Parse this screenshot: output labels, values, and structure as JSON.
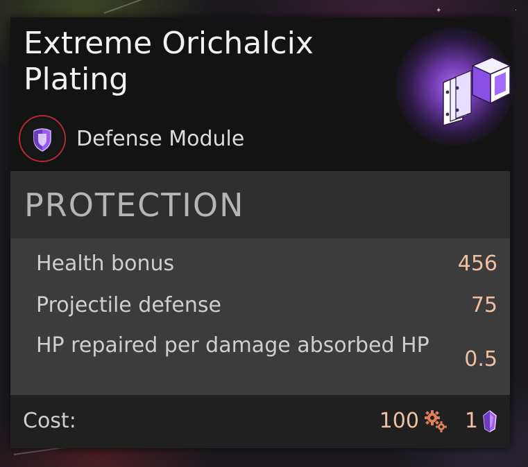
{
  "item": {
    "name": "Extreme Orichalcix Plating",
    "icon": "armor-plate-cube-icon",
    "category_icon": "shield-icon",
    "category": "Defense Module"
  },
  "section": {
    "title": "PROTECTION"
  },
  "stats": [
    {
      "label": "Health bonus",
      "value": "456"
    },
    {
      "label": "Projectile defense",
      "value": "75"
    },
    {
      "label": "HP repaired per damage absorbed HP",
      "value": "0.5"
    }
  ],
  "cost": {
    "label": "Cost:",
    "gears": "100",
    "gears_icon": "gears-icon",
    "crystals": "1",
    "crystals_icon": "crystal-icon"
  },
  "colors": {
    "accent_purple": "#9b5cf0",
    "value_peach": "#efc0a4",
    "category_ring": "#b02a35",
    "gear_orange": "#e0805a"
  }
}
